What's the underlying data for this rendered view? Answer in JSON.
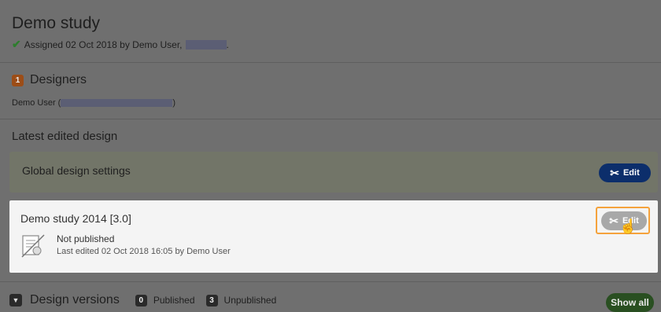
{
  "study": {
    "title": "Demo study",
    "assigned_text": "Assigned 02 Oct 2018 by Demo User,",
    "assigned_end": "."
  },
  "designers": {
    "count": "1",
    "heading": "Designers",
    "name": "Demo User (",
    "name_end": ")"
  },
  "latest": {
    "heading": "Latest edited design"
  },
  "global": {
    "label": "Global design settings",
    "edit_label": "Edit"
  },
  "design": {
    "title": "Demo study 2014 [3.0]",
    "status": "Not published",
    "last_edited": "Last edited 02 Oct 2018 16:05 by Demo User",
    "edit_label": "Edit"
  },
  "versions": {
    "heading": "Design versions",
    "published_count": "0",
    "published_label": "Published",
    "unpublished_count": "3",
    "unpublished_label": "Unpublished",
    "show_all": "Show all"
  },
  "colors": {
    "edit_blue": "#0c2e6b",
    "show_all_green": "#294f21",
    "badge_orange": "#9c4d17",
    "highlight": "#f5a23c"
  },
  "icons": [
    "check-icon",
    "tools-icon",
    "certificate-icon",
    "hand-cursor-icon",
    "chevron-down-icon"
  ]
}
